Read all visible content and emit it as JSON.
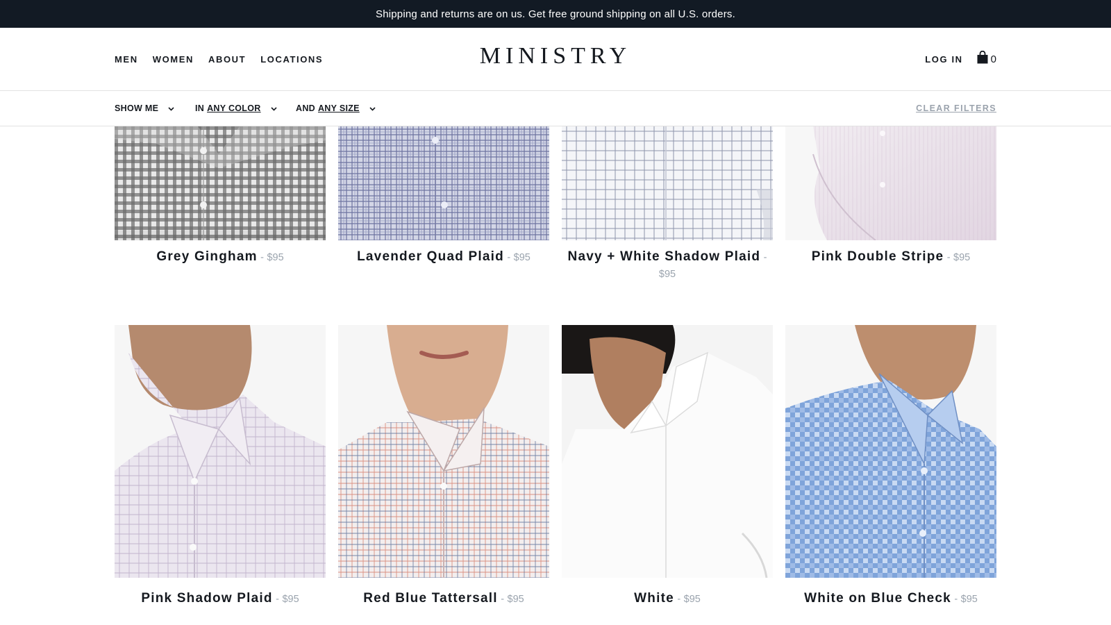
{
  "announcement": "Shipping and returns are on us. Get free ground shipping on all U.S. orders.",
  "nav": {
    "left": [
      "MEN",
      "WOMEN",
      "ABOUT",
      "LOCATIONS"
    ],
    "logo": "MINISTRY",
    "login": "LOG IN",
    "cart_count": "0"
  },
  "filters": {
    "show_me": "SHOW ME",
    "color_prefix": "IN",
    "color_value": "ANY COLOR",
    "size_prefix": "AND",
    "size_value": "ANY SIZE",
    "clear": "CLEAR FILTERS"
  },
  "products": [
    {
      "name": "Grey Gingham",
      "sep": "-",
      "price": "$95",
      "pattern": "gingham-grey"
    },
    {
      "name": "Lavender Quad Plaid",
      "sep": "-",
      "price": "$95",
      "pattern": "quad-lavender"
    },
    {
      "name": "Navy + White Shadow Plaid",
      "sep": "-",
      "price": "$95",
      "pattern": "shadow-navy"
    },
    {
      "name": "Pink Double Stripe",
      "sep": "-",
      "price": "$95",
      "pattern": "stripe-pink"
    },
    {
      "name": "Pink Shadow Plaid",
      "sep": "-",
      "price": "$95",
      "pattern": "shadow-pink"
    },
    {
      "name": "Red Blue Tattersall",
      "sep": "-",
      "price": "$95",
      "pattern": "tattersall"
    },
    {
      "name": "White",
      "sep": "-",
      "price": "$95",
      "pattern": "solid-white"
    },
    {
      "name": "White on Blue Check",
      "sep": "-",
      "price": "$95",
      "pattern": "check-blue"
    }
  ],
  "colors": {
    "announcement_bg": "#121a24",
    "text": "#15191f",
    "muted": "#9aa3ad"
  }
}
